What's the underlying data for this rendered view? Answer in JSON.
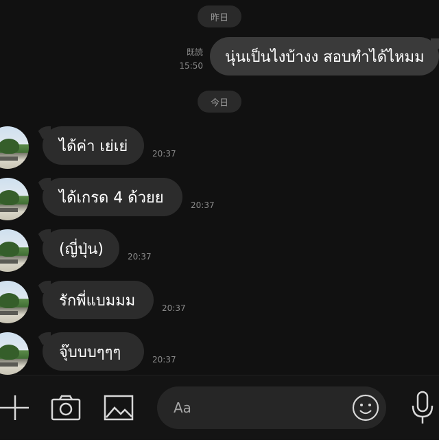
{
  "chat": {
    "date_yesterday": "昨日",
    "outgoing": {
      "read_label": "既読",
      "time": "15:50",
      "text": "นุ่นเป็นไงบ้างง สอบทำได้ไหมม"
    },
    "date_today": "今日",
    "incoming": [
      {
        "text": "ได้ค่า เย่เย่",
        "time": "20:37"
      },
      {
        "text": "ได้เกรด 4 ด้วยย",
        "time": "20:37"
      },
      {
        "text": "(ญี่ปุ่น)",
        "time": "20:37"
      },
      {
        "text": "รักพี่แบมมม",
        "time": "20:37"
      },
      {
        "text": "จุ๊บบบๆๆๆ",
        "time": "20:37"
      }
    ]
  },
  "toolbar": {
    "icons": [
      "plus-icon",
      "camera-icon",
      "image-icon",
      "emoji-icon",
      "microphone-icon"
    ],
    "input_placeholder": "Aa"
  }
}
